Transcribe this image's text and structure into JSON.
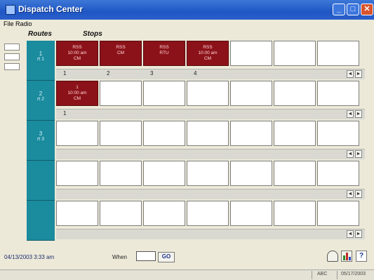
{
  "window": {
    "title": "Dispatch Center"
  },
  "menu": [
    {
      "label": "File"
    },
    {
      "label": "Radio"
    }
  ],
  "headers": {
    "routes": "Routes",
    "stops": "Stops"
  },
  "routes": [
    {
      "num": "1",
      "text": "rt 1"
    },
    {
      "num": "2",
      "text": "rt 2"
    },
    {
      "num": "3",
      "text": "rt 3"
    },
    {
      "num": "",
      "text": ""
    },
    {
      "num": "",
      "text": ""
    }
  ],
  "rows": [
    {
      "stops": [
        {
          "lines": [
            "RSS",
            "10:00 am",
            "CM"
          ],
          "active": true
        },
        {
          "lines": [
            "RSS",
            "CM",
            ""
          ],
          "active": true
        },
        {
          "lines": [
            "RSS",
            "RTU",
            ""
          ],
          "active": true
        },
        {
          "lines": [
            "RSS",
            "10:00 am",
            "CM"
          ],
          "active": true
        },
        {
          "lines": [
            "",
            "",
            ""
          ],
          "active": false
        },
        {
          "lines": [
            "",
            "",
            ""
          ],
          "active": false
        },
        {
          "lines": [
            "",
            "",
            ""
          ],
          "active": false
        }
      ],
      "labels": [
        "1",
        "2",
        "3",
        "4"
      ]
    },
    {
      "stops": [
        {
          "lines": [
            "1",
            "10:00 am",
            "CM"
          ],
          "active": true
        },
        {
          "lines": [
            "",
            "",
            ""
          ],
          "active": false
        },
        {
          "lines": [
            "",
            "",
            ""
          ],
          "active": false
        },
        {
          "lines": [
            "",
            "",
            ""
          ],
          "active": false
        },
        {
          "lines": [
            "",
            "",
            ""
          ],
          "active": false
        },
        {
          "lines": [
            "",
            "",
            ""
          ],
          "active": false
        },
        {
          "lines": [
            "",
            "",
            ""
          ],
          "active": false
        }
      ],
      "labels": [
        "1"
      ]
    },
    {
      "stops": [
        {
          "lines": [
            "",
            "",
            ""
          ],
          "active": false
        },
        {
          "lines": [
            "",
            "",
            ""
          ],
          "active": false
        },
        {
          "lines": [
            "",
            "",
            ""
          ],
          "active": false
        },
        {
          "lines": [
            "",
            "",
            ""
          ],
          "active": false
        },
        {
          "lines": [
            "",
            "",
            ""
          ],
          "active": false
        },
        {
          "lines": [
            "",
            "",
            ""
          ],
          "active": false
        },
        {
          "lines": [
            "",
            "",
            ""
          ],
          "active": false
        }
      ],
      "labels": []
    },
    {
      "stops": [
        {
          "lines": [
            "",
            "",
            ""
          ],
          "active": false
        },
        {
          "lines": [
            "",
            "",
            ""
          ],
          "active": false
        },
        {
          "lines": [
            "",
            "",
            ""
          ],
          "active": false
        },
        {
          "lines": [
            "",
            "",
            ""
          ],
          "active": false
        },
        {
          "lines": [
            "",
            "",
            ""
          ],
          "active": false
        },
        {
          "lines": [
            "",
            "",
            ""
          ],
          "active": false
        },
        {
          "lines": [
            "",
            "",
            ""
          ],
          "active": false
        }
      ],
      "labels": []
    },
    {
      "stops": [
        {
          "lines": [
            "",
            "",
            ""
          ],
          "active": false
        },
        {
          "lines": [
            "",
            "",
            ""
          ],
          "active": false
        },
        {
          "lines": [
            "",
            "",
            ""
          ],
          "active": false
        },
        {
          "lines": [
            "",
            "",
            ""
          ],
          "active": false
        },
        {
          "lines": [
            "",
            "",
            ""
          ],
          "active": false
        },
        {
          "lines": [
            "",
            "",
            ""
          ],
          "active": false
        },
        {
          "lines": [
            "",
            "",
            ""
          ],
          "active": false
        }
      ],
      "labels": []
    }
  ],
  "footer": {
    "datetime": "04/13/2003 3:33 am",
    "when_label": "When",
    "go_label": "GO",
    "help_label": "?"
  },
  "statusbar": {
    "left": "",
    "mid": "ABC",
    "right": "05/17/2003"
  },
  "colors": {
    "route": "#1b8b9e",
    "stop_active": "#8c1219",
    "title": "#1f56c4"
  },
  "icons": [
    "app-icon",
    "bell-icon",
    "chart-icon",
    "help-icon",
    "scroll-left-icon",
    "scroll-right-icon"
  ]
}
